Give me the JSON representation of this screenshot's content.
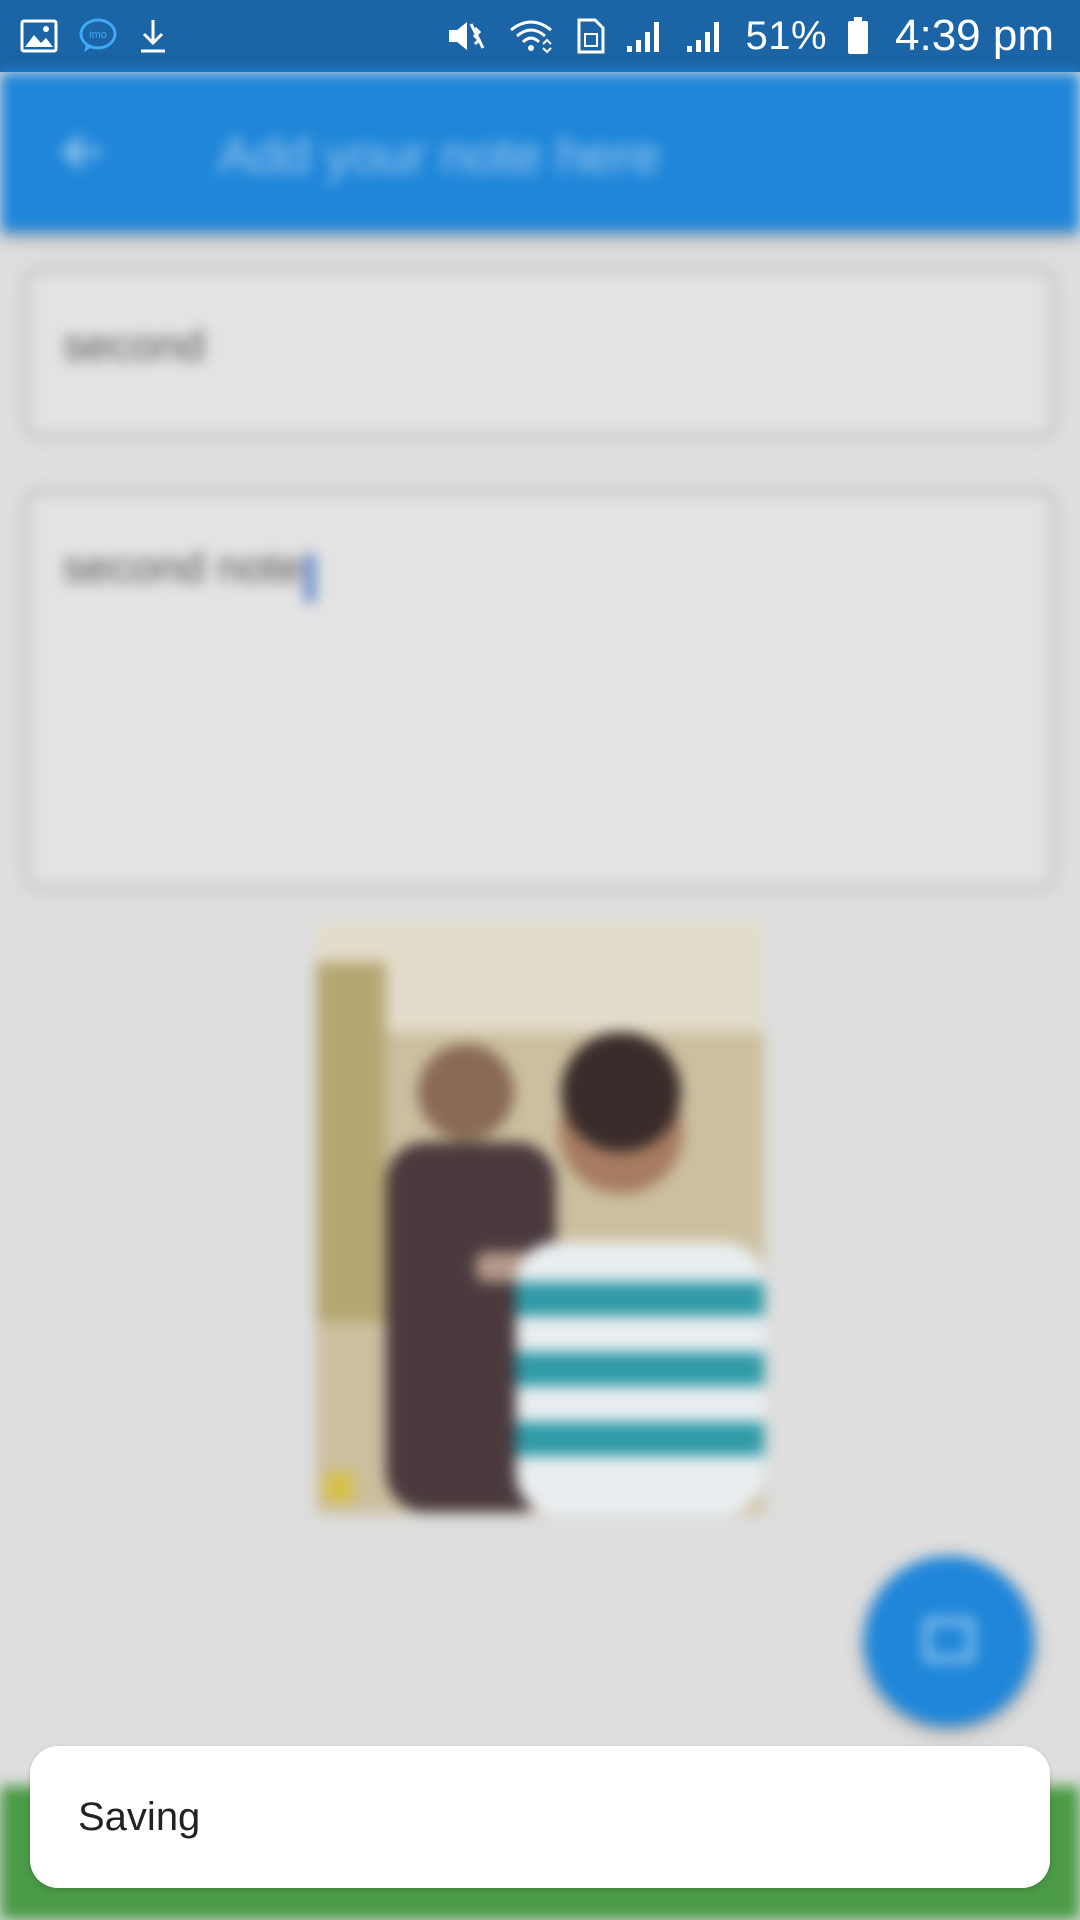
{
  "status_bar": {
    "left_icons": [
      "gallery-icon",
      "imo-icon",
      "download-icon"
    ],
    "right_icons": [
      "vibrate-icon",
      "wifi-icon",
      "sim-icon",
      "signal-icon",
      "signal-icon"
    ],
    "battery_percent": "51%",
    "time": "4:39 pm",
    "imo_label": "imo"
  },
  "app_bar": {
    "title": "Add your note here"
  },
  "note": {
    "title_value": "second",
    "body_value": "second note"
  },
  "photo": {
    "description_icon": "photo-thumbnail"
  },
  "fab": {
    "icon": "save-icon"
  },
  "toast": {
    "message": "Saving"
  },
  "colors": {
    "status_bar": "#1b64a6",
    "app_bar": "#1f86d9",
    "background": "#dedede",
    "accent_green": "#4a9a46"
  }
}
